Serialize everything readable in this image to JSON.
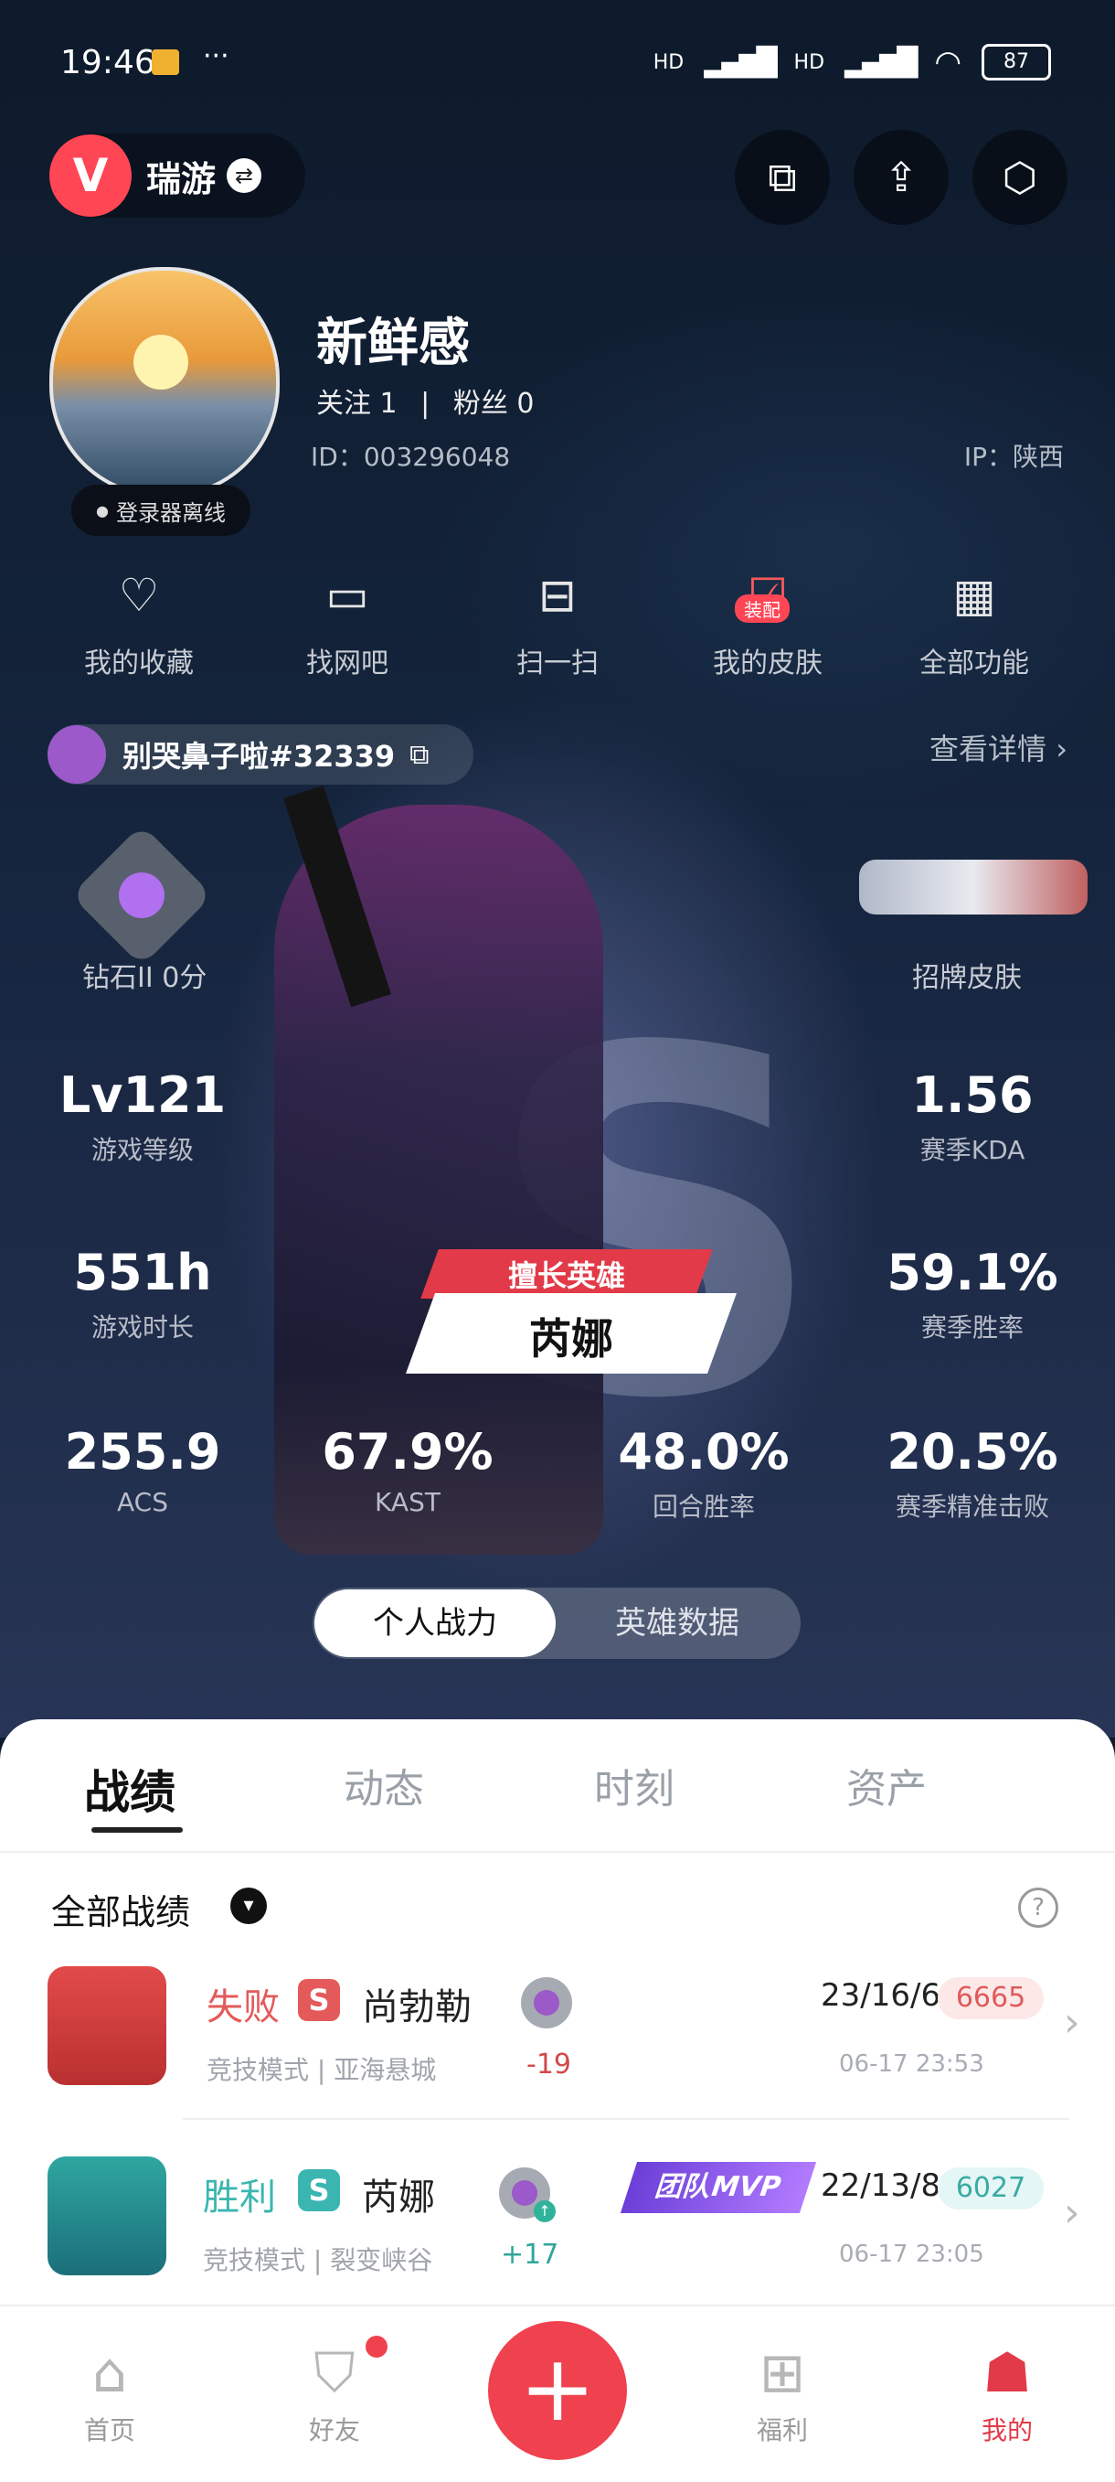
{
  "status_bar": {
    "time": "19:46",
    "signal1": "HD",
    "signal2": "HD",
    "battery": "87"
  },
  "header": {
    "game_name": "瑞游"
  },
  "profile": {
    "username": "新鲜感",
    "following": "关注 1",
    "separator": "|",
    "fans": "粉丝 0",
    "id": "ID：003296048",
    "ip": "IP：陕西",
    "login_status": "登录器离线"
  },
  "quick_actions": [
    {
      "label": "我的收藏",
      "icon": "heart-icon"
    },
    {
      "label": "找网吧",
      "icon": "monitor-icon"
    },
    {
      "label": "扫一扫",
      "icon": "scan-icon"
    },
    {
      "label": "我的皮肤",
      "icon": "skin-icon",
      "badge": "装配"
    },
    {
      "label": "全部功能",
      "icon": "grid-icon"
    }
  ],
  "riot": {
    "tag": "别哭鼻子啦#32339",
    "detail": "查看详情"
  },
  "rank": {
    "label": "钻石II 0分"
  },
  "skin": {
    "label": "招牌皮肤"
  },
  "stats": {
    "level": {
      "value": "Lv121",
      "label": "游戏等级"
    },
    "kda": {
      "value": "1.56",
      "label": "赛季KDA"
    },
    "hours": {
      "value": "551h",
      "label": "游戏时长"
    },
    "winrate": {
      "value": "59.1%",
      "label": "赛季胜率"
    },
    "acs": {
      "value": "255.9",
      "label": "ACS"
    },
    "kast": {
      "value": "67.9%",
      "label": "KAST"
    },
    "round_win": {
      "value": "48.0%",
      "label": "回合胜率"
    },
    "precision": {
      "value": "20.5%",
      "label": "赛季精准击败"
    }
  },
  "best_agent": {
    "tag": "擅长英雄",
    "name": "芮娜"
  },
  "segment": {
    "active": "个人战力",
    "inactive": "英雄数据"
  },
  "tabs": [
    "战绩",
    "动态",
    "时刻",
    "资产"
  ],
  "filter": {
    "label": "全部战绩",
    "help": "?"
  },
  "matches": [
    {
      "result": "失败",
      "badge": "S",
      "agent": "尚勃勒",
      "mode": "竞技模式 | 亚海悬城",
      "delta": "-19",
      "kda": "23/16/6",
      "score": "6665",
      "time": "06-17 23:53",
      "mvp": "",
      "accent": "#e45a5a"
    },
    {
      "result": "胜利",
      "badge": "S",
      "agent": "芮娜",
      "mode": "竞技模式 | 裂变峡谷",
      "delta": "+17",
      "kda": "22/13/8",
      "score": "6027",
      "time": "06-17 23:05",
      "mvp": "团队MVP",
      "accent": "#3bb5b0"
    }
  ],
  "nav": [
    {
      "label": "首页",
      "icon": "home-icon"
    },
    {
      "label": "好友",
      "icon": "friends-icon"
    },
    {
      "label": "福利",
      "icon": "gift-icon"
    },
    {
      "label": "我的",
      "icon": "profile-icon"
    }
  ],
  "nav_add": "+"
}
